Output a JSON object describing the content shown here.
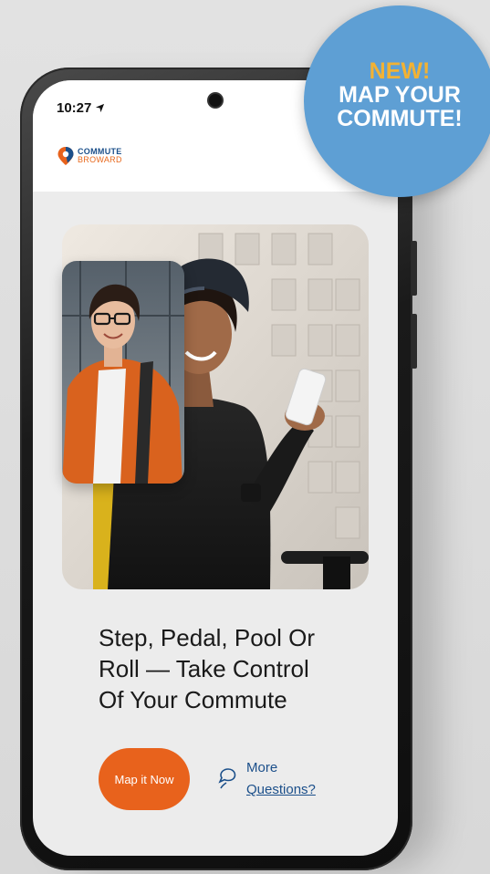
{
  "status_bar": {
    "time": "10:27",
    "location_icon": "location-arrow-icon"
  },
  "app": {
    "logo_top": "COMMUTE",
    "logo_bottom": "BROWARD",
    "logo_icon": "map-pin-icon"
  },
  "hero": {
    "main_image": "woman-cyclist-with-phone-photo",
    "inset_image": "woman-with-glasses-photo"
  },
  "headline": {
    "line1": "Step, Pedal, Pool Or",
    "line2": "Roll — Take Control",
    "line3": "Of Your Commute"
  },
  "actions": {
    "primary_label": "Map it Now",
    "secondary_line1": "More",
    "secondary_line2": "Questions?",
    "secondary_icon": "chat-bubble-icon"
  },
  "badge": {
    "line1": "NEW!",
    "line2": "MAP YOUR",
    "line3": "COMMUTE!"
  },
  "colors": {
    "accent_orange": "#e8621c",
    "brand_blue": "#1b4f8a",
    "badge_blue": "#5e9fd4",
    "badge_yellow": "#f2b233"
  }
}
